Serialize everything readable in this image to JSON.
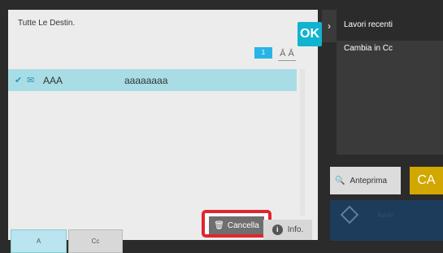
{
  "header": {
    "title": "Tutte Le Destin.",
    "ok_label": "OK"
  },
  "pager": {
    "page": "1"
  },
  "list": [
    {
      "name": "AAA",
      "address": "aaaaaaaa",
      "checked": true,
      "type_icon": "mail-icon"
    }
  ],
  "tabs": [
    {
      "label": "A",
      "selected": true
    },
    {
      "label": "Cc",
      "selected": false
    }
  ],
  "actions": {
    "cancel_label": "Cancella",
    "info_label": "Info."
  },
  "right_panel": {
    "recent_label": "Lavori recenti",
    "change_cc_label": "Cambia in Cc",
    "preview_label": "Anteprima",
    "ca_label": "CA",
    "start_label": "Avvio"
  },
  "colors": {
    "accent": "#12b3cf",
    "selected_row": "#a9dde6",
    "highlight_border": "#e0262f",
    "ca_button": "#d2a700",
    "start_button": "#1d3b5a"
  }
}
